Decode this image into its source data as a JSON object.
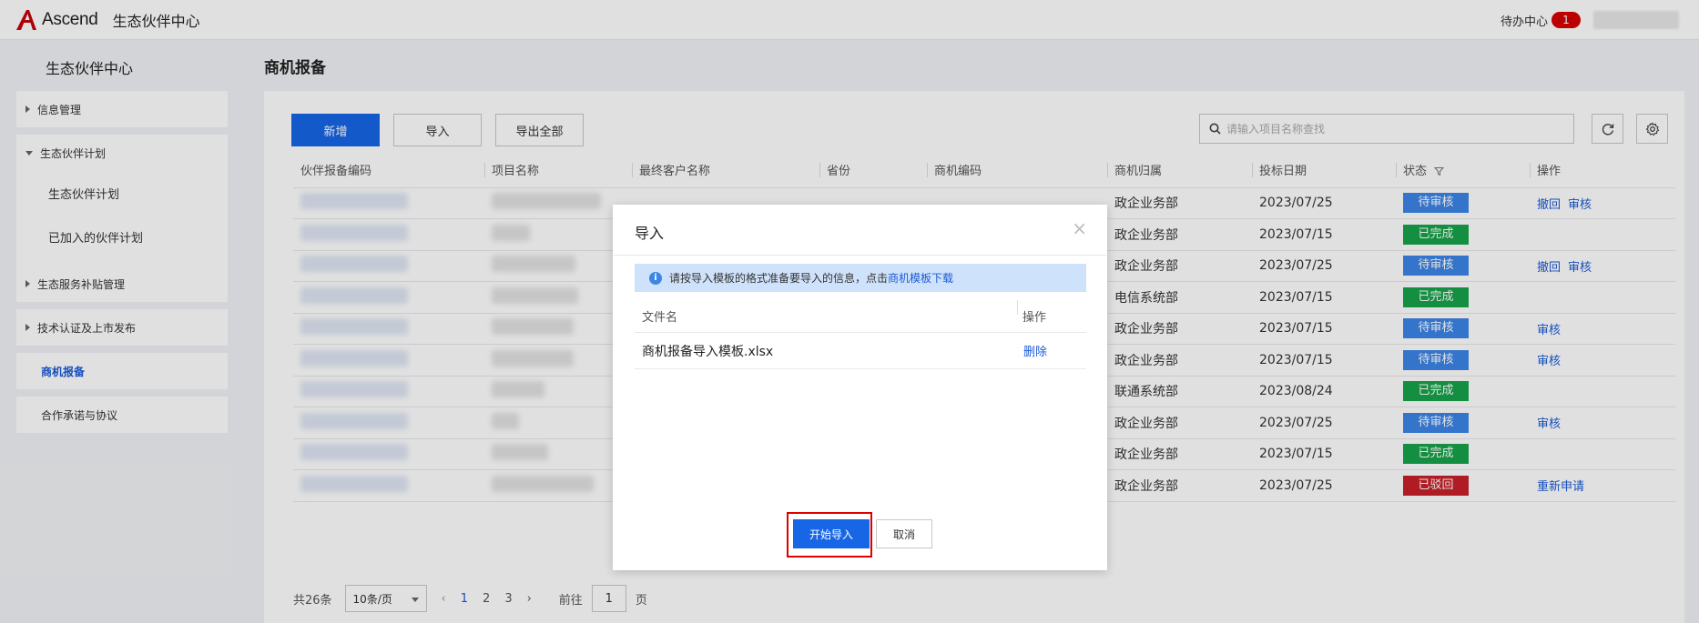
{
  "header": {
    "logo_text": "Ascend",
    "app_title": "生态伙伴中心",
    "todo_label": "待办中心",
    "todo_count": "1"
  },
  "sidebar": {
    "title": "生态伙伴中心",
    "groups": [
      {
        "label": "信息管理"
      },
      {
        "label": "生态伙伴计划",
        "children": [
          "生态伙伴计划",
          "已加入的伙伴计划"
        ]
      },
      {
        "label": "生态服务补贴管理"
      },
      {
        "label": "技术认证及上市发布"
      },
      {
        "label": "商机报备"
      },
      {
        "label": "合作承诺与协议"
      }
    ]
  },
  "main": {
    "page_title": "商机报备",
    "toolbar": {
      "add_label": "新增",
      "import_label": "导入",
      "export_label": "导出全部",
      "search_placeholder": "请输入项目名称查找"
    },
    "table": {
      "columns": [
        "伙伴报备编码",
        "项目名称",
        "最终客户名称",
        "省份",
        "商机编码",
        "商机归属",
        "投标日期",
        "状态",
        "操作"
      ],
      "rows": [
        {
          "dept": "政企业务部",
          "date": "2023/07/25",
          "status": "待审核",
          "actions": [
            "撤回",
            "审核"
          ]
        },
        {
          "dept": "政企业务部",
          "date": "2023/07/15",
          "status": "已完成",
          "actions": []
        },
        {
          "dept": "政企业务部",
          "date": "2023/07/25",
          "status": "待审核",
          "actions": [
            "撤回",
            "审核"
          ]
        },
        {
          "dept": "电信系统部",
          "date": "2023/07/15",
          "status": "已完成",
          "actions": []
        },
        {
          "dept": "政企业务部",
          "date": "2023/07/15",
          "status": "待审核",
          "actions": [
            "审核"
          ]
        },
        {
          "dept": "政企业务部",
          "date": "2023/07/15",
          "status": "待审核",
          "actions": [
            "审核"
          ]
        },
        {
          "dept": "联通系统部",
          "date": "2023/08/24",
          "status": "已完成",
          "actions": []
        },
        {
          "dept": "政企业务部",
          "date": "2023/07/25",
          "status": "待审核",
          "actions": [
            "审核"
          ]
        },
        {
          "dept": "政企业务部",
          "date": "2023/07/15",
          "status": "已完成",
          "actions": []
        },
        {
          "dept": "政企业务部",
          "date": "2023/07/25",
          "status": "已驳回",
          "actions": [
            "重新申请"
          ]
        }
      ]
    },
    "pager": {
      "total": "共26条",
      "page_size": "10条/页",
      "pages": [
        "1",
        "2",
        "3"
      ],
      "goto_label": "前往",
      "goto_value": "1",
      "page_unit": "页"
    }
  },
  "modal": {
    "title": "导入",
    "notice_text": "请按导入模板的格式准备要导入的信息，点击",
    "notice_link": "商机模板下载",
    "file_col": "文件名",
    "op_col": "操作",
    "file_name": "商机报备导入模板.xlsx",
    "delete_label": "删除",
    "start_label": "开始导入",
    "cancel_label": "取消"
  },
  "colors": {
    "primary": "#1766e6",
    "pending": "#3c86e8",
    "done": "#17a34a",
    "rejected": "#c8202a",
    "brand_red": "#c7000b"
  }
}
